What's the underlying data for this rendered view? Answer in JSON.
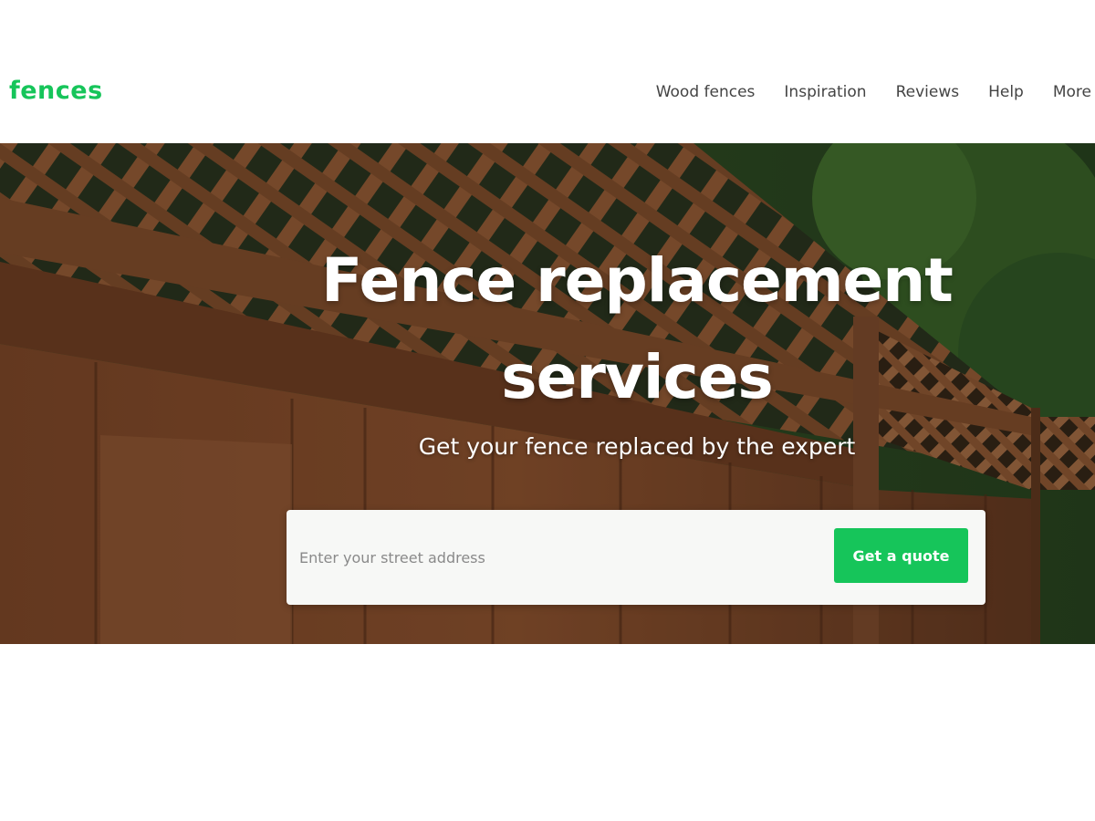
{
  "brand": {
    "logo_text": "fences",
    "accent_color": "#16c55a"
  },
  "nav": {
    "items": [
      {
        "label": "Wood fences"
      },
      {
        "label": "Inspiration"
      },
      {
        "label": "Reviews"
      },
      {
        "label": "Help"
      },
      {
        "label": "More"
      }
    ]
  },
  "hero": {
    "title_line1": "Fence replacement",
    "title_line2": "services",
    "subtitle": "Get your fence replaced by the expert",
    "background_image": "wooden-lattice-fence-photo",
    "search": {
      "placeholder": "Enter your street address",
      "value": "",
      "button_label": "Get a quote"
    }
  }
}
